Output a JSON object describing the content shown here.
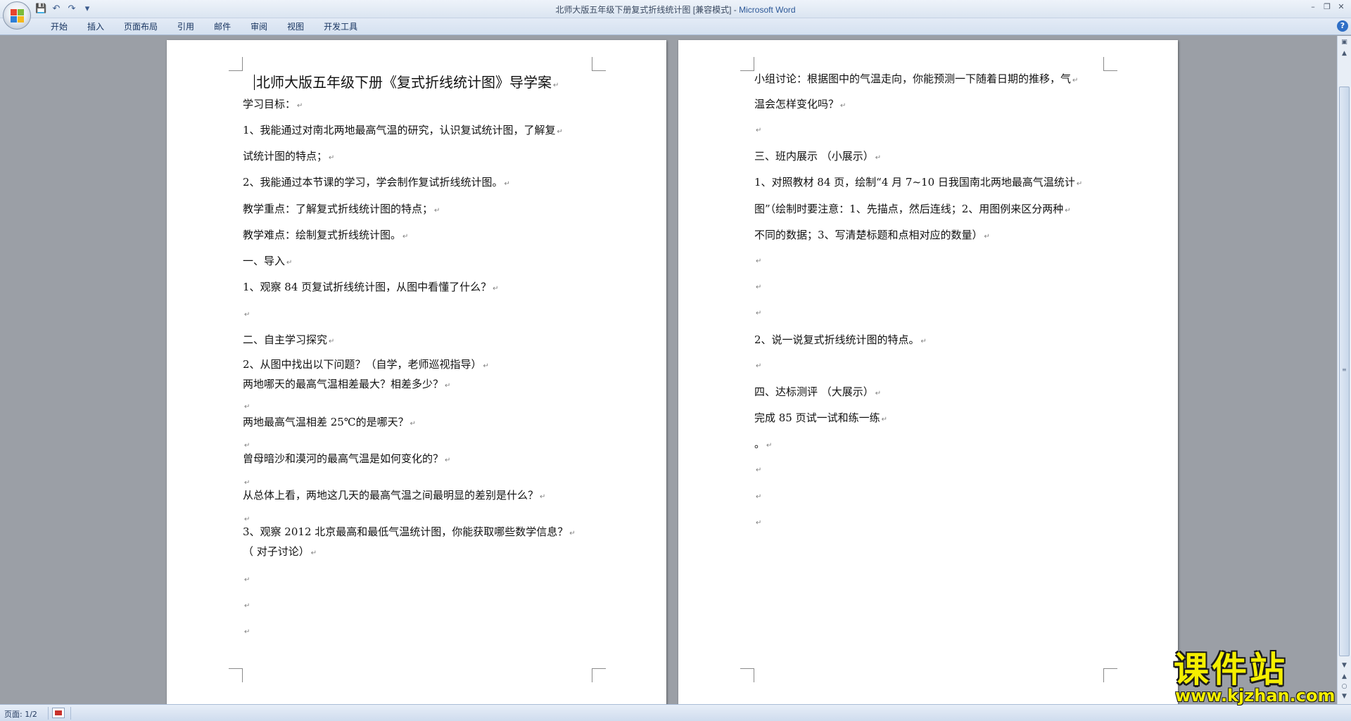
{
  "window": {
    "title": "北师大版五年级下册复式折线统计图 [兼容模式]",
    "title_separator": " - ",
    "app_name": "Microsoft Word"
  },
  "quick_access": {
    "icons": [
      "save-icon",
      "undo-icon",
      "redo-icon",
      "customize-dropdown-icon"
    ]
  },
  "ribbon": {
    "tabs": [
      "开始",
      "插入",
      "页面布局",
      "引用",
      "邮件",
      "审阅",
      "视图",
      "开发工具"
    ]
  },
  "paragraph_mark": "↵",
  "page_left": {
    "lines": [
      "北师大版五年级下册《复式折线统计图》导学案",
      "学习目标：",
      "1、我能通过对南北两地最高气温的研究，认识复试统计图，了解复",
      "试统计图的特点；",
      "2、我能通过本节课的学习，学会制作复试折线统计图。",
      "教学重点：了解复式折线统计图的特点；",
      "教学难点：绘制复式折线统计图。",
      "一、导入",
      "1、观察 84 页复试折线统计图，从图中看懂了什么？",
      "",
      "二、自主学习探究",
      "2、从图中找出以下问题？（自学，老师巡视指导）",
      "两地哪天的最高气温相差最大？相差多少？",
      "",
      "两地最高气温相差 25℃的是哪天？",
      "",
      "曾母暗沙和漠河的最高气温是如何变化的？",
      "",
      "从总体上看，两地这几天的最高气温之间最明显的差别是什么？",
      "",
      "3、观察 2012 北京最高和最低气温统计图，你能获取哪些数学信息？",
      "（  对子讨论）",
      "",
      "",
      ""
    ]
  },
  "page_right": {
    "lines": [
      "小组讨论：根据图中的气温走向，你能预测一下随着日期的推移，气",
      "温会怎样变化吗？",
      "",
      "三、班内展示  （小展示）",
      "1、对照教材 84 页，绘制“4 月 7~10 日我国南北两地最高气温统计",
      "图”（绘制时要注意：1、先描点，然后连线；2、用图例来区分两种",
      "不同的数据；3、写清楚标题和点相对应的数量）",
      "",
      "",
      "",
      "2、说一说复式折线统计图的特点。",
      "",
      "四、达标测评  （大展示）",
      "完成 85 页试一试和练一练",
      "。",
      "",
      "",
      ""
    ]
  },
  "status_bar": {
    "page_info": "页面: 1/2"
  },
  "watermark": {
    "main": "课件站",
    "url": "www.kjzhan.com"
  }
}
